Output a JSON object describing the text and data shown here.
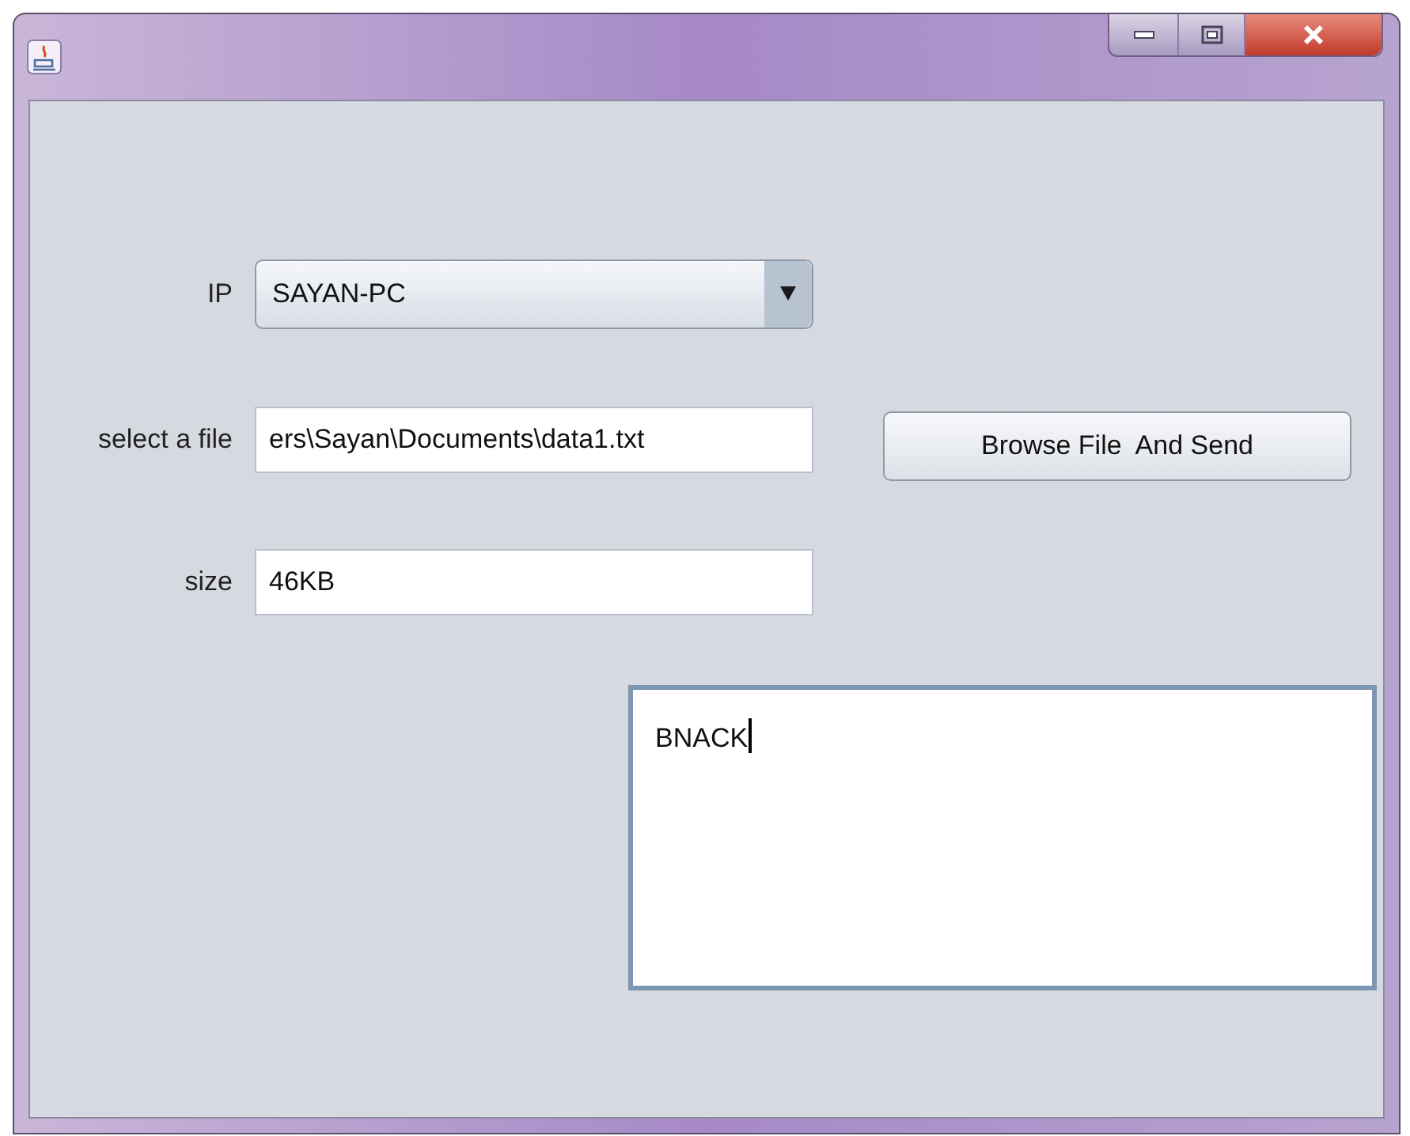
{
  "window": {
    "controls": [
      {
        "kind": "minimize"
      },
      {
        "kind": "maximize"
      },
      {
        "kind": "close"
      }
    ]
  },
  "form": {
    "ip": {
      "label": "IP",
      "value": "SAYAN-PC"
    },
    "file": {
      "label": "select a file",
      "value": "ers\\Sayan\\Documents\\data1.txt"
    },
    "browse_button": "Browse File  And Send",
    "size": {
      "label": "size",
      "value": "46KB"
    },
    "output": "BNACK"
  }
}
